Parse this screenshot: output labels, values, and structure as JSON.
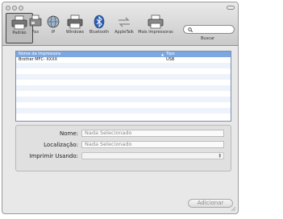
{
  "toolbar": {
    "items": [
      {
        "label": "Padrão",
        "icon": "printer-icon"
      },
      {
        "label": "Fax",
        "icon": "fax-icon"
      },
      {
        "label": "IP",
        "icon": "globe-icon"
      },
      {
        "label": "Windows",
        "icon": "windows-printer-icon"
      },
      {
        "label": "Bluetooth",
        "icon": "bluetooth-icon"
      },
      {
        "label": "AppleTalk",
        "icon": "appletalk-icon"
      },
      {
        "label": "Mais Impressoras",
        "icon": "more-printers-icon"
      }
    ],
    "search_label": "Buscar"
  },
  "table": {
    "headers": [
      "Nome da Impressora",
      "Tipo"
    ],
    "rows": [
      {
        "name": "Brother MFC- XXXX",
        "type": "USB"
      }
    ]
  },
  "form": {
    "name_label": "Nome:",
    "name_value": "Nada Selecionado",
    "location_label": "Localização:",
    "location_value": "Nada Selecionado",
    "print_using_label": "Imprimir Usando:"
  },
  "add_button": "Adicionar",
  "colors": {
    "header_blue": "#7da7e0",
    "row_alt": "#eef3fb"
  }
}
